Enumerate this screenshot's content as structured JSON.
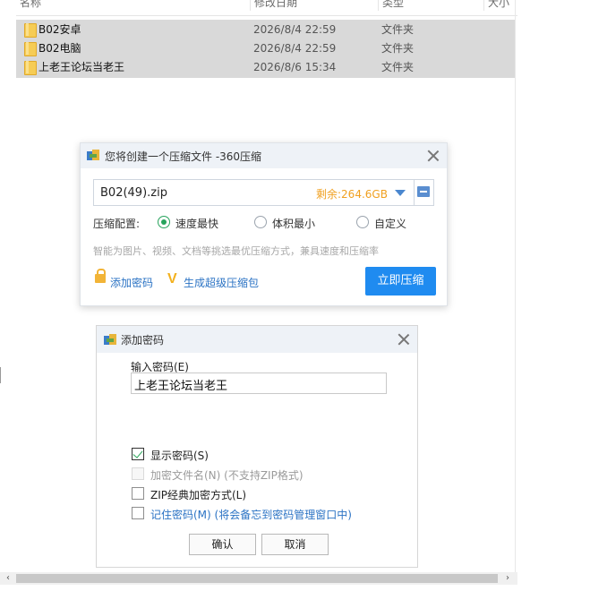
{
  "explorer": {
    "columns": [
      "名称",
      "修改日期",
      "类型",
      "大小"
    ],
    "rows": [
      {
        "name": "B02安卓",
        "date": "2026/8/4 22:59",
        "type": "文件夹"
      },
      {
        "name": "B02电脑",
        "date": "2026/8/4 22:59",
        "type": "文件夹"
      },
      {
        "name": "上老王论坛当老王",
        "date": "2026/8/6 15:34",
        "type": "文件夹"
      }
    ],
    "scroll_left": "‹",
    "scroll_right": "›"
  },
  "compress_dialog": {
    "title": "您将创建一个压缩文件 -360压缩",
    "filename": "B02(49).zip",
    "free_space": "剩余:264.6GB",
    "config_label": "压缩配置:",
    "options": [
      "速度最快",
      "体积最小",
      "自定义"
    ],
    "selected_option": "速度最快",
    "hint": "智能为图片、视频、文档等挑选最优压缩方式，兼具速度和压缩率",
    "add_password_link": "添加密码",
    "super_package_link": "生成超级压缩包",
    "compress_button": "立即压缩",
    "accent_color": "#1f8bf0"
  },
  "password_dialog": {
    "title": "添加密码",
    "input_label": "输入密码(E)",
    "password_value": "上老王论坛当老王",
    "checkboxes": [
      {
        "label": "显示密码(S)",
        "checked": true,
        "disabled": false
      },
      {
        "label": "加密文件名(N) (不支持ZIP格式)",
        "checked": false,
        "disabled": true
      },
      {
        "label": "ZIP经典加密方式(L)",
        "checked": false,
        "disabled": false
      },
      {
        "label": "记住密码(M) (将会备忘到密码管理窗口中)",
        "checked": false,
        "disabled": false
      }
    ],
    "ok_button": "确认",
    "cancel_button": "取消"
  }
}
